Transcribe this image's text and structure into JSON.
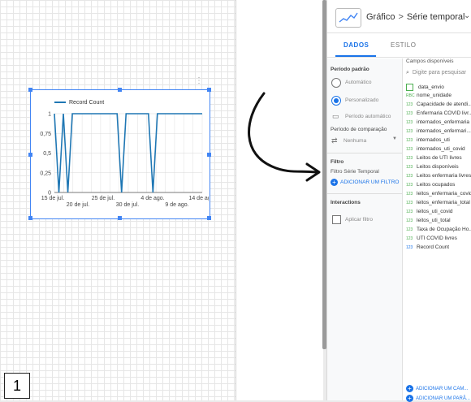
{
  "canvas": {
    "legend_label": "Record Count",
    "step_number": "1"
  },
  "chart_data": {
    "type": "line",
    "title": "",
    "xlabel": "",
    "ylabel": "",
    "ylim": [
      0,
      1
    ],
    "y_ticks": [
      "0",
      "0,25",
      "0,5",
      "0,75",
      "1"
    ],
    "x_ticks_top": [
      "15 de jul.",
      "25 de jul.",
      "4 de ago.",
      "14 de ago."
    ],
    "x_ticks_bottom": [
      "20 de jul.",
      "30 de jul.",
      "9 de ago."
    ],
    "series": [
      {
        "name": "Record Count",
        "color": "#1f77b4",
        "points": [
          [
            0,
            1
          ],
          [
            1,
            0
          ],
          [
            2,
            1
          ],
          [
            3,
            0
          ],
          [
            4,
            1
          ],
          [
            5,
            1
          ],
          [
            6,
            1
          ],
          [
            7,
            1
          ],
          [
            8,
            1
          ],
          [
            9,
            1
          ],
          [
            10,
            1
          ],
          [
            11,
            1
          ],
          [
            12,
            1
          ],
          [
            13,
            1
          ],
          [
            14,
            1
          ],
          [
            15,
            0
          ],
          [
            16,
            1
          ],
          [
            17,
            1
          ],
          [
            18,
            1
          ],
          [
            19,
            1
          ],
          [
            20,
            1
          ],
          [
            21,
            1
          ],
          [
            22,
            0
          ],
          [
            23,
            1
          ],
          [
            24,
            1
          ],
          [
            25,
            1
          ],
          [
            26,
            1
          ],
          [
            27,
            1
          ],
          [
            28,
            1
          ],
          [
            29,
            1
          ],
          [
            30,
            1
          ],
          [
            31,
            1
          ],
          [
            32,
            1
          ],
          [
            33,
            1
          ]
        ]
      }
    ]
  },
  "panel": {
    "breadcrumb_chart": "Gráfico",
    "breadcrumb_sep": ">",
    "breadcrumb_type": "Série temporal",
    "tabs": [
      "DADOS",
      "ESTILO"
    ],
    "left": {
      "period_title": "Período padrão",
      "automatic": "Automático",
      "custom": "Personalizado",
      "auto_period": "Período automático",
      "comparison_title": "Período de comparação",
      "comparison_value": "Nenhuma",
      "filter_title": "Filtro",
      "filter_sub": "Filtro Série Temporal",
      "add_filter": "ADICIONAR UM FILTRO",
      "interactions_title": "Interactions",
      "apply_filter": "Aplicar filtro"
    },
    "right": {
      "title": "Campos disponíveis",
      "search_placeholder": "Digite para pesquisar",
      "fields": [
        {
          "type": "date",
          "name": "data_envio"
        },
        {
          "type": "RBC",
          "name": "nome_unidade"
        },
        {
          "type": "123",
          "name": "Capacidade de atendi..."
        },
        {
          "type": "123",
          "name": "Enfermaria COVID livr..."
        },
        {
          "type": "123",
          "name": "internados_enfermaria"
        },
        {
          "type": "123",
          "name": "internados_enfermari..."
        },
        {
          "type": "123",
          "name": "internados_uti"
        },
        {
          "type": "123",
          "name": "internados_uti_covid"
        },
        {
          "type": "123",
          "name": "Leitos de UTI livres"
        },
        {
          "type": "123",
          "name": "Leitos disponíveis"
        },
        {
          "type": "123",
          "name": "Leitos enfermaria livres"
        },
        {
          "type": "123",
          "name": "Leitos ocupados"
        },
        {
          "type": "123",
          "name": "leitos_enfermaria_covid"
        },
        {
          "type": "123",
          "name": "leitos_enfermaria_total"
        },
        {
          "type": "123",
          "name": "leitos_uti_covid"
        },
        {
          "type": "123",
          "name": "leitos_uti_total"
        },
        {
          "type": "123",
          "name": "Taxa de Ocupação Ho..."
        },
        {
          "type": "123",
          "name": "UTI COVID livres"
        },
        {
          "type": "123",
          "name": "Record Count"
        }
      ],
      "add_field": "ADICIONAR UM CAM...",
      "add_param": "ADICIONAR UM PARÂ..."
    }
  }
}
